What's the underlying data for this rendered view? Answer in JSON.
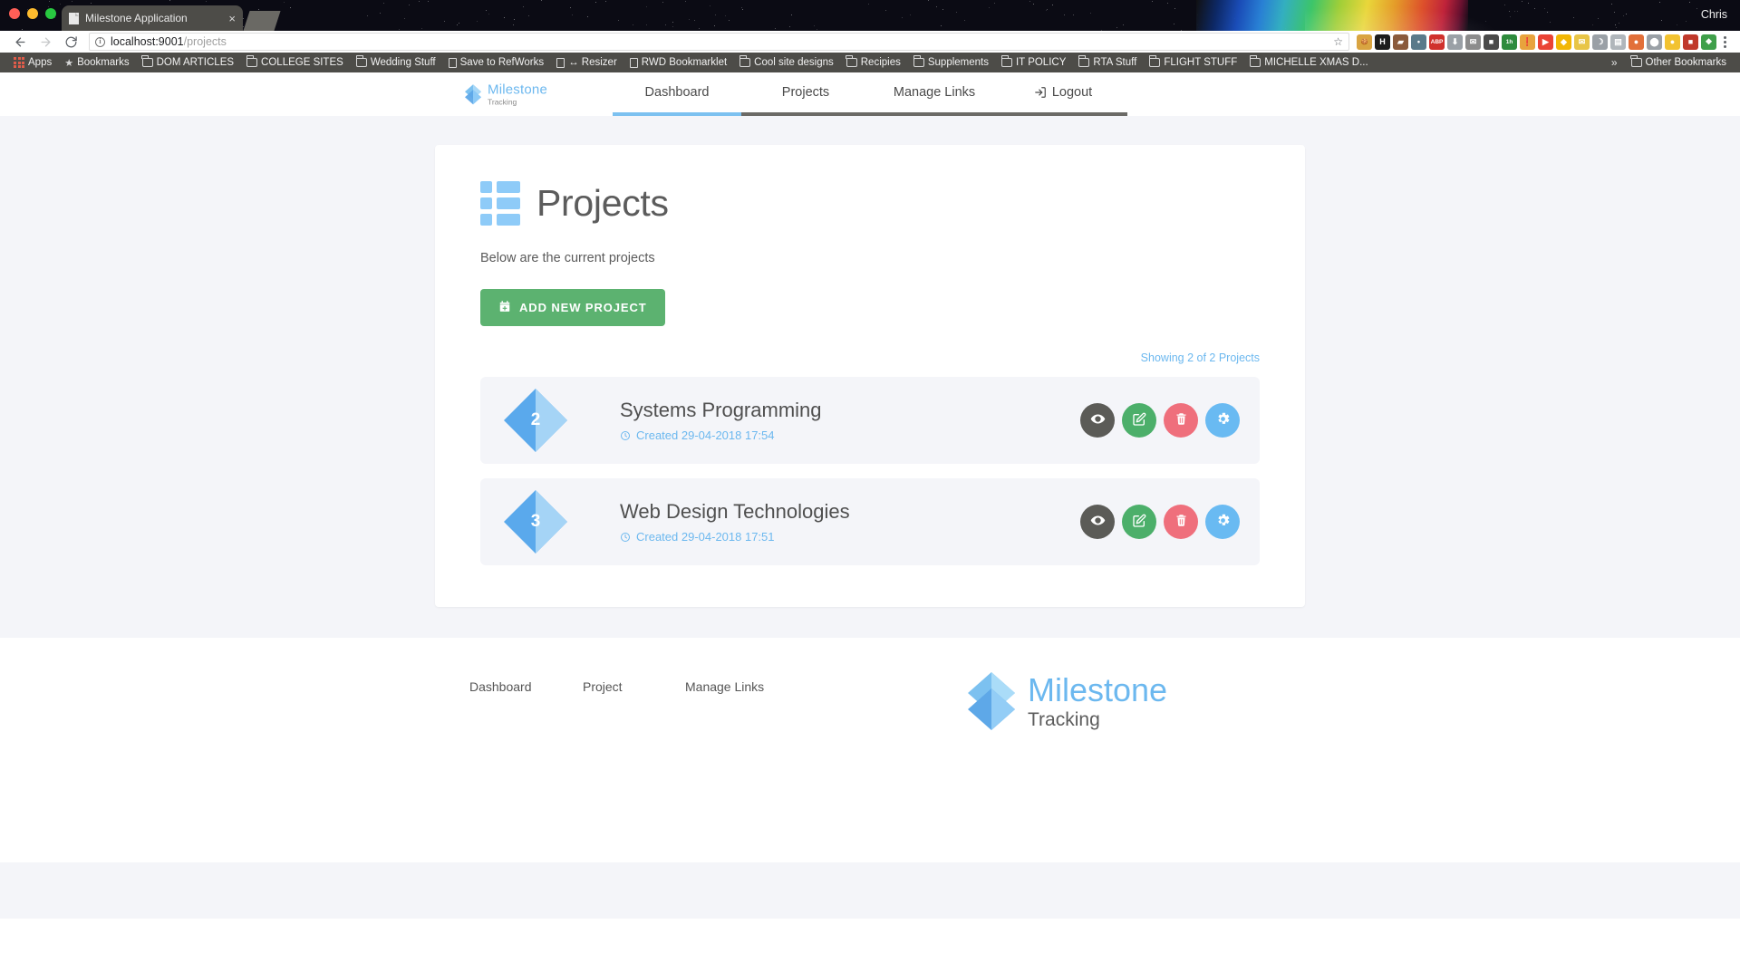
{
  "browser": {
    "tab_title": "Milestone Application",
    "user_name": "Chris",
    "url_host": "localhost:9001",
    "url_path": "/projects",
    "close_glyph": "×",
    "star_glyph": "☆",
    "bookmarks": [
      {
        "label": "Apps",
        "icon": "apps-grid-icon"
      },
      {
        "label": "Bookmarks",
        "icon": "star-icon"
      },
      {
        "label": "DOM ARTICLES",
        "icon": "folder-icon"
      },
      {
        "label": "COLLEGE SITES",
        "icon": "folder-icon"
      },
      {
        "label": "Wedding Stuff",
        "icon": "folder-icon"
      },
      {
        "label": "Save to RefWorks",
        "icon": "page-icon"
      },
      {
        "label": "↔ Resizer",
        "icon": "page-icon"
      },
      {
        "label": "RWD Bookmarklet",
        "icon": "page-icon"
      },
      {
        "label": "Cool site designs",
        "icon": "folder-icon"
      },
      {
        "label": "Recipies",
        "icon": "folder-icon"
      },
      {
        "label": "Supplements",
        "icon": "folder-icon"
      },
      {
        "label": "IT POLICY",
        "icon": "folder-icon"
      },
      {
        "label": "RTA Stuff",
        "icon": "folder-icon"
      },
      {
        "label": "FLIGHT STUFF",
        "icon": "folder-icon"
      },
      {
        "label": "MICHELLE XMAS D...",
        "icon": "folder-icon"
      }
    ],
    "overflow_glyph": "»",
    "other_bookmarks": "Other Bookmarks",
    "extensions": [
      {
        "name": "cookie-extension-icon",
        "color": "#d9a441",
        "glyph": "🍪"
      },
      {
        "name": "honey-extension-icon",
        "color": "#1c1c1c",
        "glyph": "H"
      },
      {
        "name": "pocket-extension-icon",
        "color": "#8a5a3c",
        "glyph": "▰"
      },
      {
        "name": "ghostery-extension-icon",
        "color": "#5a7a8a",
        "glyph": "•"
      },
      {
        "name": "adblock-plus-extension-icon",
        "color": "#d0312d",
        "glyph": "ABP"
      },
      {
        "name": "download-extension-icon",
        "color": "#9aa0a6",
        "glyph": "⬇"
      },
      {
        "name": "mail-extension-icon",
        "color": "#8c8c8c",
        "glyph": "✉"
      },
      {
        "name": "camera-extension-icon",
        "color": "#4a4a4a",
        "glyph": "■"
      },
      {
        "name": "timer-extension-icon",
        "color": "#2e8b3d",
        "glyph": "1h"
      },
      {
        "name": "pin-extension-icon",
        "color": "#e8a33d",
        "glyph": "❗"
      },
      {
        "name": "flow-extension-icon",
        "color": "#ea4335",
        "glyph": "▶"
      },
      {
        "name": "sketch-extension-icon",
        "color": "#f2b705",
        "glyph": "◆"
      },
      {
        "name": "envelope-extension-icon",
        "color": "#e8c547",
        "glyph": "✉"
      },
      {
        "name": "moon-extension-icon",
        "color": "#9aa0a6",
        "glyph": "☽"
      },
      {
        "name": "doc-extension-icon",
        "color": "#b0b6bb",
        "glyph": "▤"
      },
      {
        "name": "basketball-extension-icon",
        "color": "#e2703a",
        "glyph": "●"
      },
      {
        "name": "shield-extension-icon",
        "color": "#9aa0a6",
        "glyph": "⬤"
      },
      {
        "name": "circle-extension-icon",
        "color": "#f2c230",
        "glyph": "●"
      },
      {
        "name": "red-extension-icon",
        "color": "#c0392b",
        "glyph": "■"
      },
      {
        "name": "puzzle-extension-icon",
        "color": "#3f9f4a",
        "glyph": "❖"
      }
    ]
  },
  "app": {
    "brand": {
      "main": "Milestone",
      "sub": "Tracking"
    },
    "nav": [
      {
        "label": "Dashboard",
        "active": true,
        "icon": null
      },
      {
        "label": "Projects",
        "active": false,
        "icon": null
      },
      {
        "label": "Manage Links",
        "active": false,
        "icon": null
      },
      {
        "label": "Logout",
        "active": false,
        "icon": "logout-icon"
      }
    ],
    "page": {
      "title": "Projects",
      "icon": "list-icon",
      "subtitle": "Below are the current projects",
      "add_button": "ADD NEW PROJECT",
      "add_button_icon": "calendar-plus-icon",
      "showing": "Showing 2 of 2 Projects"
    },
    "projects": [
      {
        "number": "2",
        "name": "Systems Programming",
        "created_label": "Created 29-04-2018 17:54",
        "actions": [
          {
            "name": "view-project-button",
            "icon": "eye-icon"
          },
          {
            "name": "edit-project-button",
            "icon": "pencil-square-icon"
          },
          {
            "name": "delete-project-button",
            "icon": "trash-icon"
          },
          {
            "name": "settings-project-button",
            "icon": "gear-icon"
          }
        ]
      },
      {
        "number": "3",
        "name": "Web Design Technologies",
        "created_label": "Created 29-04-2018 17:51",
        "actions": [
          {
            "name": "view-project-button",
            "icon": "eye-icon"
          },
          {
            "name": "edit-project-button",
            "icon": "pencil-square-icon"
          },
          {
            "name": "delete-project-button",
            "icon": "trash-icon"
          },
          {
            "name": "settings-project-button",
            "icon": "gear-icon"
          }
        ]
      }
    ],
    "footer": {
      "links": [
        "Dashboard",
        "Project",
        "Manage Links"
      ],
      "brand_main": "Milestone",
      "brand_sub": "Tracking"
    },
    "colors": {
      "accent_blue": "#6cb8ef",
      "light_blue": "#8ecbf8",
      "green": "#5cb270",
      "edit_green": "#4caf6a",
      "delete_red": "#ef6f7c",
      "gear_blue": "#69baf2",
      "view_gray": "#5b5b57",
      "page_bg": "#f4f5f9"
    }
  }
}
